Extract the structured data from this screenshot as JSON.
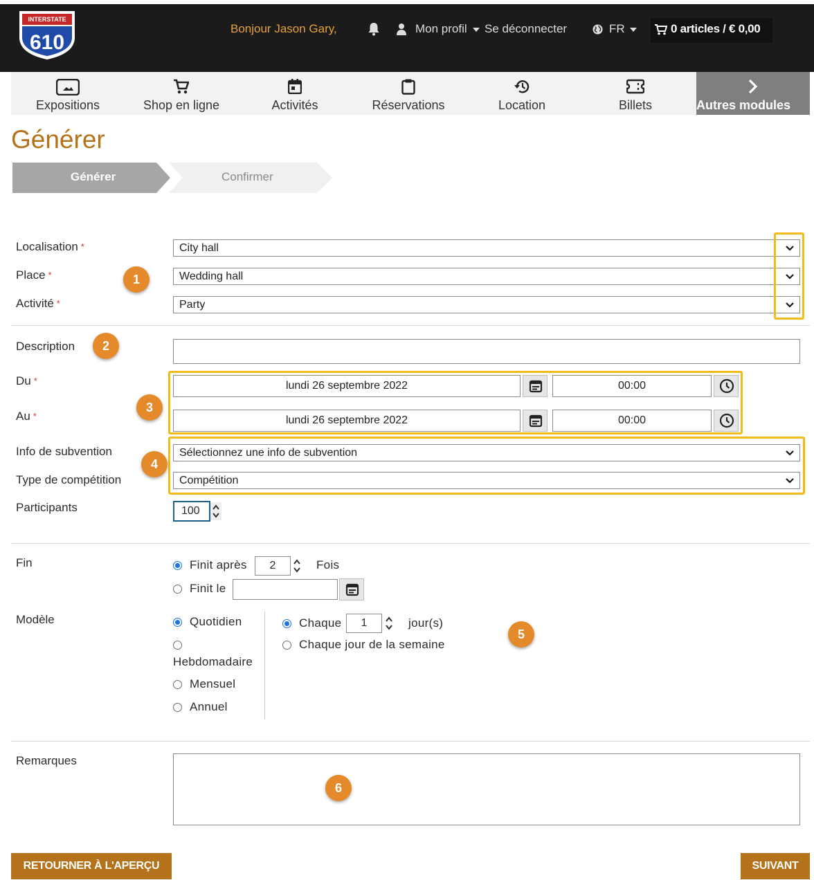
{
  "header": {
    "logo_top_text": "INTERSTATE",
    "logo_number": "610",
    "greeting": "Bonjour Jason Gary,",
    "profile_label": "Mon profil",
    "logout_label": "Se déconnecter",
    "language": "FR",
    "cart_label": "0 articles / € 0,00"
  },
  "nav": {
    "items": [
      {
        "label": "Expositions",
        "icon": "image-icon"
      },
      {
        "label": "Shop en ligne",
        "icon": "cart-icon"
      },
      {
        "label": "Activités",
        "icon": "calendar-icon"
      },
      {
        "label": "Réservations",
        "icon": "clipboard-icon"
      },
      {
        "label": "Location",
        "icon": "history-icon"
      },
      {
        "label": "Billets",
        "icon": "ticket-icon"
      }
    ],
    "more_label": "Autres modules"
  },
  "page": {
    "title": "Générer",
    "steps": [
      "Générer",
      "Confirmer"
    ],
    "active_step": 0
  },
  "form": {
    "localisation": {
      "label": "Localisation",
      "value": "City hall"
    },
    "place": {
      "label": "Place",
      "value": "Wedding hall"
    },
    "activite": {
      "label": "Activité",
      "value": "Party"
    },
    "description": {
      "label": "Description",
      "value": ""
    },
    "du": {
      "label": "Du",
      "date": "lundi 26 septembre 2022",
      "time": "00:00"
    },
    "au": {
      "label": "Au",
      "date": "lundi 26 septembre 2022",
      "time": "00:00"
    },
    "subvention": {
      "label": "Info de subvention",
      "value": "Sélectionnez une info de subvention"
    },
    "competition": {
      "label": "Type de compétition",
      "value": "Compétition"
    },
    "participants": {
      "label": "Participants",
      "value": "100"
    },
    "required_mark": "*"
  },
  "recurrence": {
    "fin_label": "Fin",
    "finit_apres_label": "Finit après",
    "finit_apres_value": "2",
    "fois_label": "Fois",
    "finit_le_label": "Finit le",
    "finit_le_value": "",
    "modele_label": "Modèle",
    "patterns": [
      "Quotidien",
      "Hebdomadaire",
      "Mensuel",
      "Annuel"
    ],
    "selected_pattern": "Quotidien",
    "chaque_label": "Chaque",
    "chaque_value": "1",
    "jours_label": "jour(s)",
    "chaque_jour_semaine_label": "Chaque jour de la semaine"
  },
  "remarks": {
    "label": "Remarques",
    "value": ""
  },
  "buttons": {
    "back": "RETOURNER À L'APERÇU",
    "next": "SUIVANT"
  },
  "annotations": [
    "1",
    "2",
    "3",
    "4",
    "5",
    "6"
  ],
  "colors": {
    "accent": "#b4731a",
    "highlight": "#f2bb19",
    "badge": "#e48a2a",
    "header_bg": "#1b1b1b",
    "required": "#c23b3b"
  }
}
